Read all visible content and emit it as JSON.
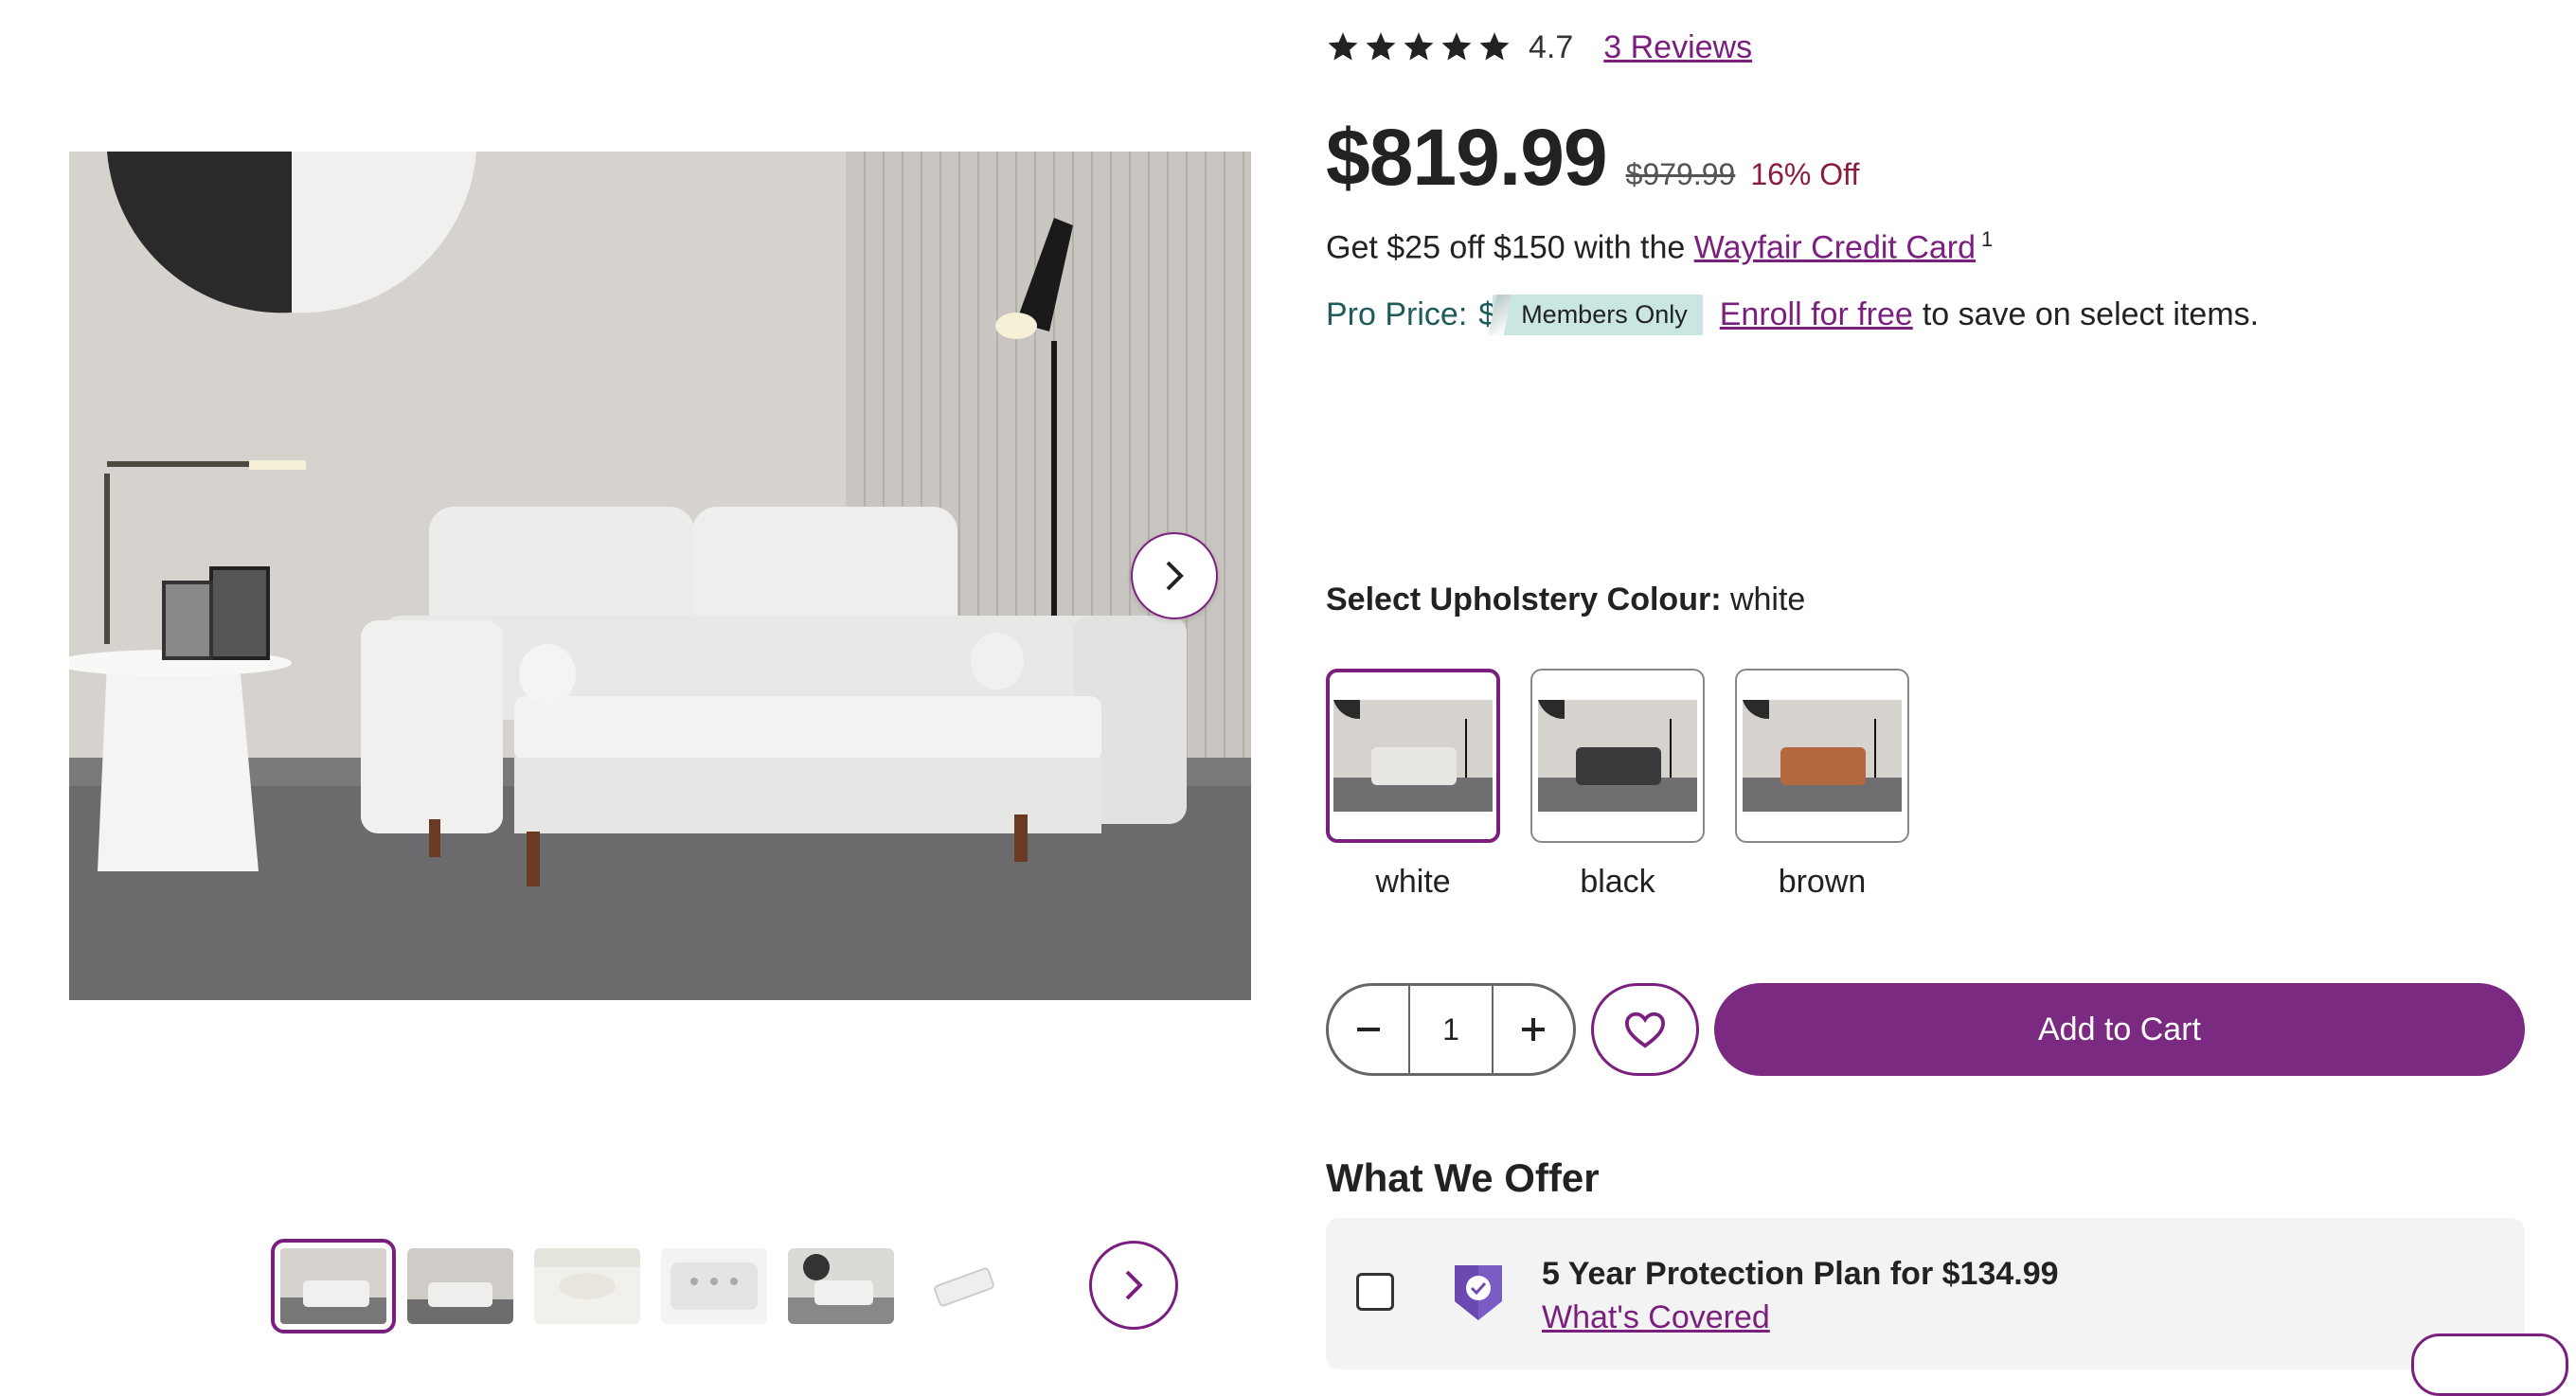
{
  "rating": {
    "value": "4.7",
    "stars": 5,
    "reviews_link": "3 Reviews"
  },
  "pricing": {
    "price": "$819.99",
    "was_price": "$979.99",
    "discount": "16% Off",
    "credit_offer_text": "Get $25 off $150 with the ",
    "credit_link": "Wayfair Credit Card",
    "credit_footnote": "1",
    "pro_label": "Pro Price:",
    "pro_dollar": "$",
    "members_badge": "Members Only",
    "enroll_link": "Enroll for free",
    "pro_tail": "to save on select items."
  },
  "colour": {
    "title": "Select Upholstery Colour:",
    "selected": "white",
    "options": [
      {
        "label": "white",
        "sofa_color": "#e9e7e3"
      },
      {
        "label": "black",
        "sofa_color": "#3a3a3c"
      },
      {
        "label": "brown",
        "sofa_color": "#b4683f"
      }
    ]
  },
  "cart": {
    "quantity": "1",
    "add_to_cart": "Add to Cart"
  },
  "offers": {
    "title": "What We Offer",
    "protection_title": "5 Year Protection Plan for $134.99",
    "protection_link": "What's Covered"
  },
  "gallery": {
    "thumbnail_count": 6,
    "selected_index": 0
  },
  "colors": {
    "accent": "#7b1f7f",
    "discount": "#8b1c3a",
    "pro": "#1d5c5a",
    "members_bg": "#c9e6e3"
  }
}
